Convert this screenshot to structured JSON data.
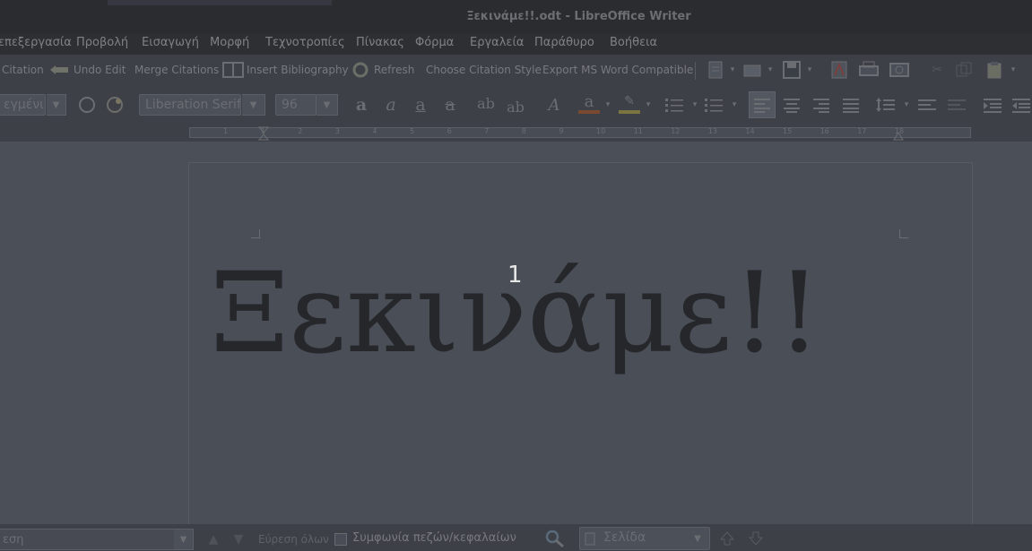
{
  "window": {
    "title": "Ξεκινάμε!!.odt - LibreOffice Writer"
  },
  "menu": [
    "επεξεργασία",
    "Προβολή",
    "Εισαγωγή",
    "Μορφή",
    "Τεχνοτροπίες",
    "Πίνακας",
    "Φόρμα",
    "Εργαλεία",
    "Παράθυρο",
    "Βοήθεια"
  ],
  "toolbar1": {
    "citation": "Citation",
    "undo_edit": "Undo Edit",
    "merge_citations": "Merge Citations",
    "insert_bibliography": "Insert Bibliography",
    "refresh": "Refresh",
    "choose_style": "Choose Citation Style",
    "export_word": "Export MS Word Compatible"
  },
  "toolbar2": {
    "paragraph_style": "εγμένι",
    "font_name": "Liberation Serif",
    "font_size": "96"
  },
  "ruler": {
    "ticks": [
      "1",
      "1",
      "2",
      "3",
      "4",
      "5",
      "6",
      "7",
      "8",
      "9",
      "10",
      "11",
      "12",
      "13",
      "14",
      "15",
      "16",
      "17",
      "18"
    ]
  },
  "document": {
    "text": "Ξεκινάμε!!",
    "page_number": "1"
  },
  "findbar": {
    "search_value": "εση",
    "find_all": "Εύρεση όλων",
    "match_case": "Συμφωνία πεζών/κεφαλαίων",
    "search_scope": "Σελίδα"
  },
  "icons": {
    "undo": "undo-edit-icon",
    "book": "insert-bibliography-icon",
    "refresh": "refresh-icon"
  }
}
